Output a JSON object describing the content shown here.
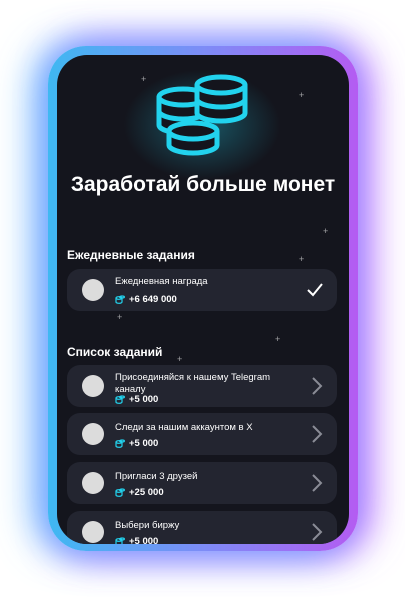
{
  "header": {
    "title": "Заработай больше монет",
    "coins_icon": "coin-stack-icon",
    "accent": "#22d3ee"
  },
  "daily": {
    "heading": "Ежедневные задания",
    "items": [
      {
        "label": "Ежедневная награда",
        "reward": "+6 649 000",
        "status": "completed"
      }
    ]
  },
  "tasks": {
    "heading": "Список заданий",
    "items": [
      {
        "label": "Присоединяйся к нашему Telegram каналу",
        "reward": "+5 000"
      },
      {
        "label": "Следи за нашим аккаунтом в X",
        "reward": "+5 000"
      },
      {
        "label": "Пригласи 3 друзей",
        "reward": "+25 000"
      },
      {
        "label": "Выбери биржу",
        "reward": "+5 000"
      }
    ]
  },
  "colors": {
    "screen_bg": "#14151d",
    "card_bg": "#232530",
    "frame_left": "#3fb8f2",
    "frame_right": "#b45cf2"
  }
}
